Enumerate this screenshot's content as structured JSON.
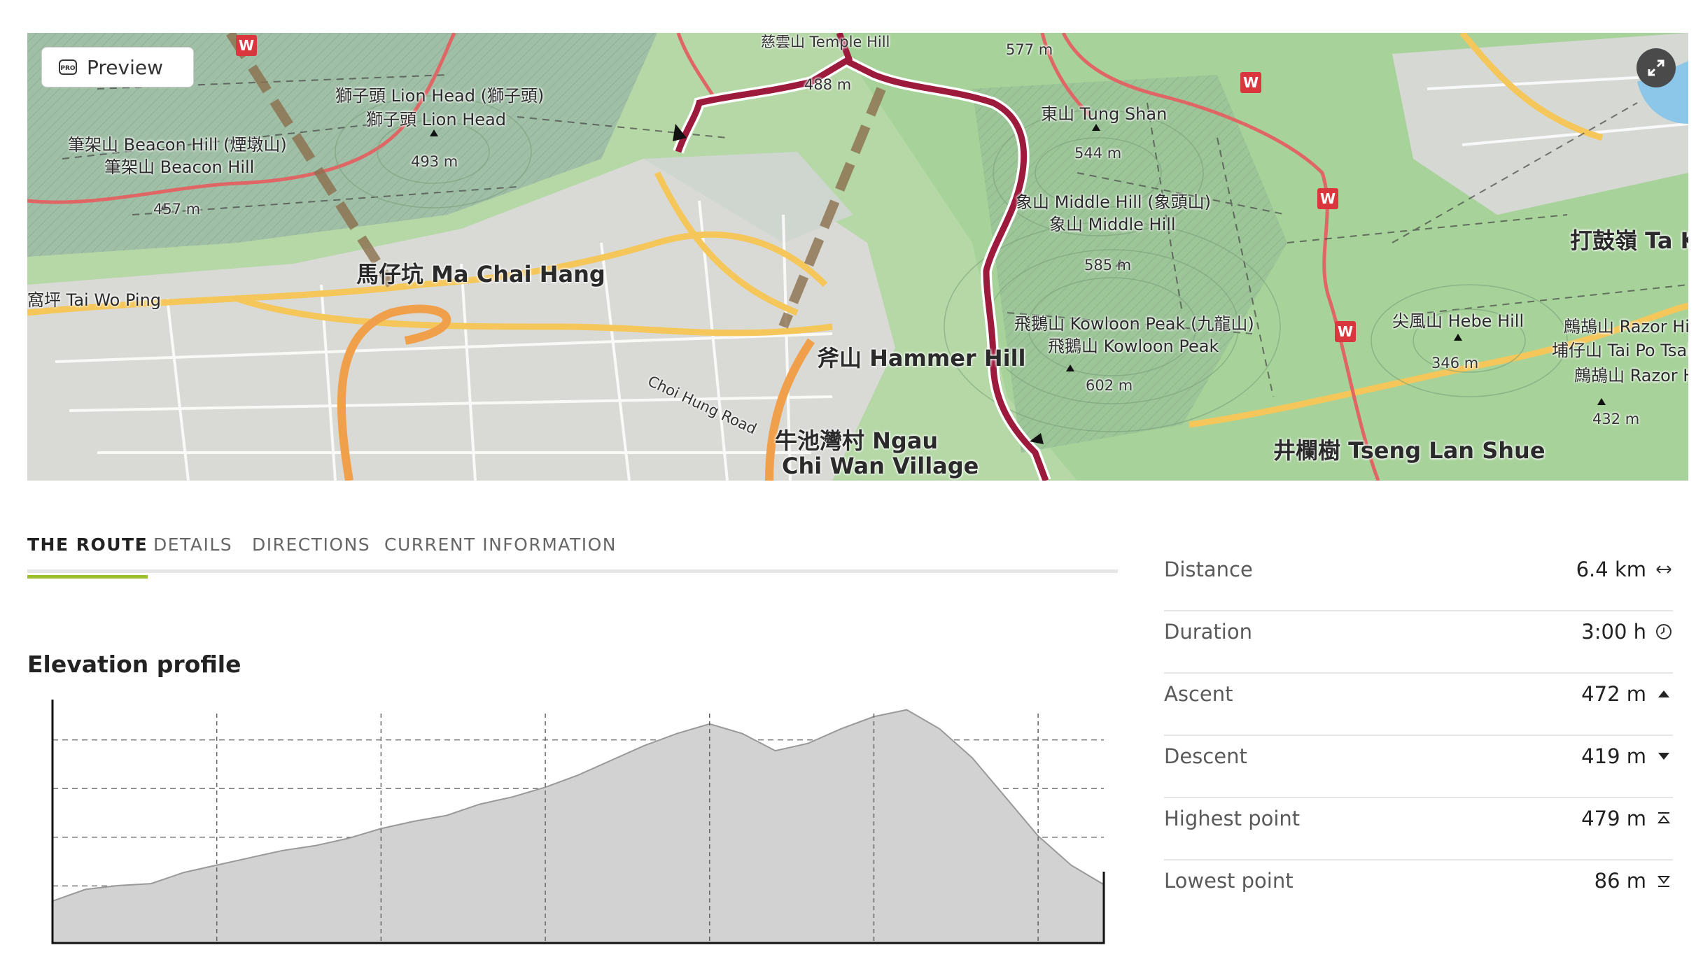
{
  "map": {
    "preview_label": "Preview",
    "labels": [
      {
        "text": "慈雲山 Temple Hill",
        "cls": "small"
      },
      {
        "text": "577 m",
        "cls": "small"
      },
      {
        "text": "488 m",
        "cls": "small"
      },
      {
        "text": "獅子頭 Lion Head (獅子頭)",
        "cls": ""
      },
      {
        "text": "獅子頭 Lion Head",
        "cls": ""
      },
      {
        "text": "493 m",
        "cls": "small"
      },
      {
        "text": "筆架山 Beacon Hill (煙墩山)",
        "cls": ""
      },
      {
        "text": "筆架山 Beacon Hill",
        "cls": ""
      },
      {
        "text": "457 m",
        "cls": "small"
      },
      {
        "text": "東山 Tung Shan",
        "cls": ""
      },
      {
        "text": "544 m",
        "cls": "small"
      },
      {
        "text": "象山 Middle Hill (象頭山)",
        "cls": ""
      },
      {
        "text": "象山 Middle Hill",
        "cls": ""
      },
      {
        "text": "585 m",
        "cls": "small"
      },
      {
        "text": "打鼓嶺 Ta K",
        "cls": "big"
      },
      {
        "text": "馬仔坑 Ma Chai Hang",
        "cls": "big"
      },
      {
        "text": "窩坪 Tai Wo Ping",
        "cls": ""
      },
      {
        "text": "飛鵝山 Kowloon Peak (九龍山)",
        "cls": ""
      },
      {
        "text": "飛鵝山 Kowloon Peak",
        "cls": ""
      },
      {
        "text": "602 m",
        "cls": "small"
      },
      {
        "text": "尖風山 Hebe Hill",
        "cls": ""
      },
      {
        "text": "346 m",
        "cls": "small"
      },
      {
        "text": "鷓鴣山 Razor Hill",
        "cls": ""
      },
      {
        "text": "埔仔山 Tai Po Tsai",
        "cls": ""
      },
      {
        "text": "鷓鴣山 Razor H",
        "cls": ""
      },
      {
        "text": "432 m",
        "cls": "small"
      },
      {
        "text": "斧山 Hammer Hill",
        "cls": "big"
      },
      {
        "text": "Choi Hung Road",
        "cls": "small"
      },
      {
        "text": "牛池灣村 Ngau",
        "cls": "big"
      },
      {
        "text": "Chi Wan Village",
        "cls": "big"
      },
      {
        "text": "井欄樹 Tseng Lan Shue",
        "cls": "big"
      }
    ],
    "trail_badge": "W"
  },
  "tabs": [
    {
      "label": "THE ROUTE",
      "active": true
    },
    {
      "label": "DETAILS",
      "active": false
    },
    {
      "label": "DIRECTIONS",
      "active": false
    },
    {
      "label": "CURRENT INFORMATION",
      "active": false
    }
  ],
  "elevation": {
    "title": "Elevation profile"
  },
  "stats": [
    {
      "label": "Distance",
      "value": "6.4 km",
      "icon": "distance-arrows-icon"
    },
    {
      "label": "Duration",
      "value": "3:00 h",
      "icon": "clock-icon"
    },
    {
      "label": "Ascent",
      "value": "472 m",
      "icon": "triangle-up-icon"
    },
    {
      "label": "Descent",
      "value": "419 m",
      "icon": "triangle-down-icon"
    },
    {
      "label": "Highest point",
      "value": "479 m",
      "icon": "highest-point-icon"
    },
    {
      "label": "Lowest point",
      "value": "86 m",
      "icon": "lowest-point-icon"
    }
  ],
  "chart_data": {
    "type": "area",
    "title": "Elevation profile",
    "xlabel": "",
    "ylabel": "",
    "unit": "m",
    "ylim": [
      0,
      500
    ],
    "grid": true,
    "x": [
      0,
      0.2,
      0.4,
      0.6,
      0.8,
      1.0,
      1.2,
      1.4,
      1.6,
      1.8,
      2.0,
      2.2,
      2.4,
      2.6,
      2.8,
      3.0,
      3.2,
      3.4,
      3.6,
      3.8,
      4.0,
      4.2,
      4.4,
      4.6,
      4.8,
      5.0,
      5.2,
      5.4,
      5.6,
      5.8,
      6.0,
      6.2,
      6.4
    ],
    "series": [
      {
        "values": [
          86,
          110,
          118,
          122,
          145,
          160,
          175,
          190,
          200,
          215,
          235,
          250,
          262,
          285,
          300,
          320,
          345,
          375,
          405,
          430,
          450,
          430,
          395,
          410,
          440,
          465,
          479,
          440,
          380,
          300,
          220,
          160,
          120
        ]
      }
    ]
  }
}
